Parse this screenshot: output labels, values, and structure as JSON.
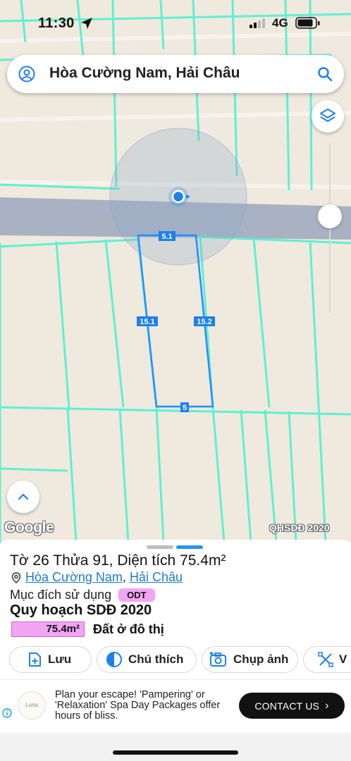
{
  "status_bar": {
    "time": "11:30",
    "network": "4G"
  },
  "search": {
    "query": "Hòa Cường Nam, Hải Châu"
  },
  "map": {
    "plot_dims": {
      "top": "5.1",
      "left": "15.1",
      "right": "15.2",
      "bottom": "5"
    },
    "google_label": "Google",
    "layer_label": "QHSDĐ 2020",
    "accent_color": "#33e6c8",
    "plot_color": "#1e90ff"
  },
  "sheet": {
    "title_prefix": "Tờ 26 Thửa 91, ",
    "title_area": "Diện tích 75.4m²",
    "ward": "Hòa Cường Nam",
    "separator": ",",
    "district": "Hải Châu",
    "purpose_label": "Mục đích sử dụng",
    "purpose_code": "ODT",
    "plan_title": "Quy hoạch SDĐ 2020",
    "plan_area": "75.4m²",
    "plan_type": "Đất ở đô thị",
    "actions": [
      {
        "label": "Lưu",
        "icon": "add-note-icon"
      },
      {
        "label": "Chú thích",
        "icon": "half-circle-icon"
      },
      {
        "label": "Chụp ảnh",
        "icon": "camera-icon"
      },
      {
        "label": "V",
        "icon": "measure-icon"
      }
    ]
  },
  "ad": {
    "logo_text": "Luna",
    "copy": "Plan your escape! 'Pampering' or 'Relaxation' Spa Day Packages offer hours of bliss.",
    "cta": "CONTACT US"
  }
}
